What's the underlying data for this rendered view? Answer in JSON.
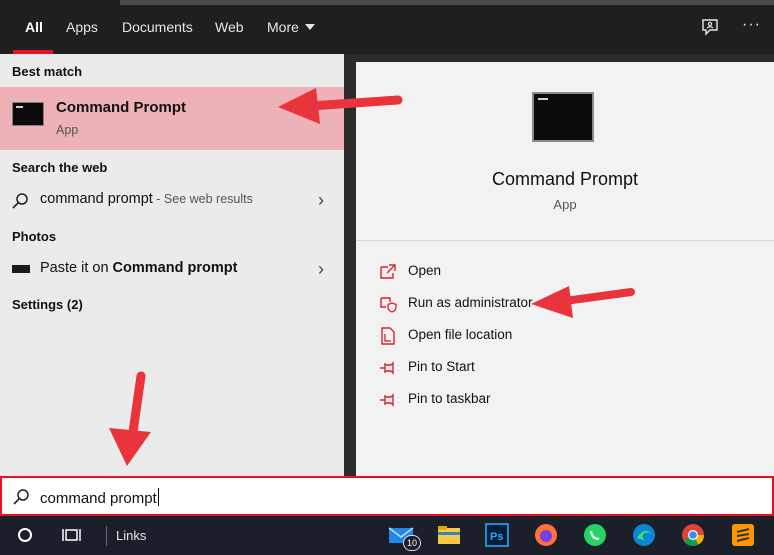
{
  "tabs": [
    {
      "label": "All",
      "active": true
    },
    {
      "label": "Apps"
    },
    {
      "label": "Documents"
    },
    {
      "label": "Web"
    },
    {
      "label": "More"
    }
  ],
  "left": {
    "best_match_label": "Best match",
    "best_item": {
      "title": "Command Prompt",
      "subtitle": "App"
    },
    "search_web_label": "Search the web",
    "web_result": {
      "query": "command prompt",
      "hint": " - See web results"
    },
    "photos_label": "Photos",
    "paste_result": {
      "prefix": "Paste it on ",
      "bold": "Command prompt"
    },
    "settings_label": "Settings (2)"
  },
  "right": {
    "title": "Command Prompt",
    "subtitle": "App",
    "actions": [
      {
        "label": "Open",
        "icon": "open-icon"
      },
      {
        "label": "Run as administrator",
        "icon": "shield-icon"
      },
      {
        "label": "Open file location",
        "icon": "file-location-icon"
      },
      {
        "label": "Pin to Start",
        "icon": "pin-icon"
      },
      {
        "label": "Pin to taskbar",
        "icon": "pin-icon"
      }
    ]
  },
  "search": {
    "value": "command prompt"
  },
  "taskbar": {
    "links_label": "Links",
    "mail_badge": "10",
    "apps": [
      "start-icon",
      "task-view-icon",
      "mail-icon",
      "file-explorer-icon",
      "photoshop-icon",
      "firefox-icon",
      "whatsapp-icon",
      "edge-icon",
      "chrome-icon",
      "sublime-icon"
    ]
  },
  "colors": {
    "accent": "#e81123",
    "highlight": "#eeb1b8",
    "arrow": "#e8343a"
  }
}
